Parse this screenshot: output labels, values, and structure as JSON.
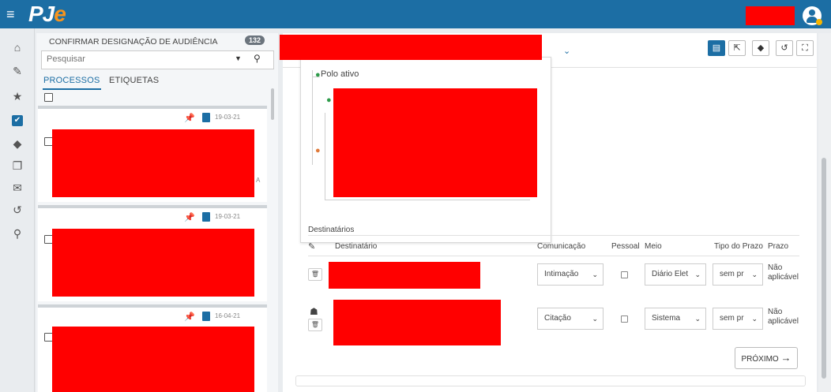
{
  "app": {
    "logo_p": "PJ",
    "logo_e": "e",
    "menu_glyph": "≡"
  },
  "rail": {
    "icons": [
      {
        "name": "home-icon",
        "glyph": "⌂"
      },
      {
        "name": "pencil-icon",
        "glyph": "✎"
      },
      {
        "name": "star-icon",
        "glyph": "★"
      },
      {
        "name": "checkbox-icon",
        "glyph": "✔"
      },
      {
        "name": "tags-icon",
        "glyph": "◆"
      },
      {
        "name": "copy-icon",
        "glyph": "❐"
      },
      {
        "name": "envelope-icon",
        "glyph": "✉"
      },
      {
        "name": "history-icon",
        "glyph": "↺"
      },
      {
        "name": "search-icon",
        "glyph": "⚲"
      }
    ]
  },
  "panel": {
    "title": "CONFIRMAR DESIGNAÇÃO DE AUDIÊNCIA",
    "count": "132",
    "search_placeholder": "Pesquisar",
    "tabs": [
      {
        "label": "PROCESSOS"
      },
      {
        "label": "ETIQUETAS"
      }
    ],
    "cards": [
      {
        "date": "19-03-21",
        "edge_text": "A"
      },
      {
        "date": "19-03-21"
      },
      {
        "date": "16-04-21"
      }
    ]
  },
  "tree": {
    "polo_ativo": "Polo ativo"
  },
  "toolbar": {
    "buttons": [
      "▤",
      "⇱",
      "◆",
      "↺",
      "⛶"
    ]
  },
  "destinatarios": {
    "section_title": "Destinatários",
    "headers": {
      "destinatario": "Destinatário",
      "comunicacao": "Comunicação",
      "pessoal": "Pessoal",
      "meio": "Meio",
      "tipo_prazo": "Tipo do Prazo",
      "prazo": "Prazo"
    },
    "rows": [
      {
        "comunicacao": "Intimação",
        "meio": "Diário Elet",
        "tipo_prazo": "sem pr",
        "prazo_line1": "Não",
        "prazo_line2": "aplicável"
      },
      {
        "comunicacao": "Citação",
        "meio": "Sistema",
        "tipo_prazo": "sem pr",
        "prazo_line1": "Não",
        "prazo_line2": "aplicável"
      }
    ]
  },
  "next_button": {
    "label": "PRÓXIMO",
    "arrow": "→"
  },
  "colors": {
    "primary": "#1c6ea4",
    "accent": "#f7941d",
    "redaction": "#ff0000"
  }
}
